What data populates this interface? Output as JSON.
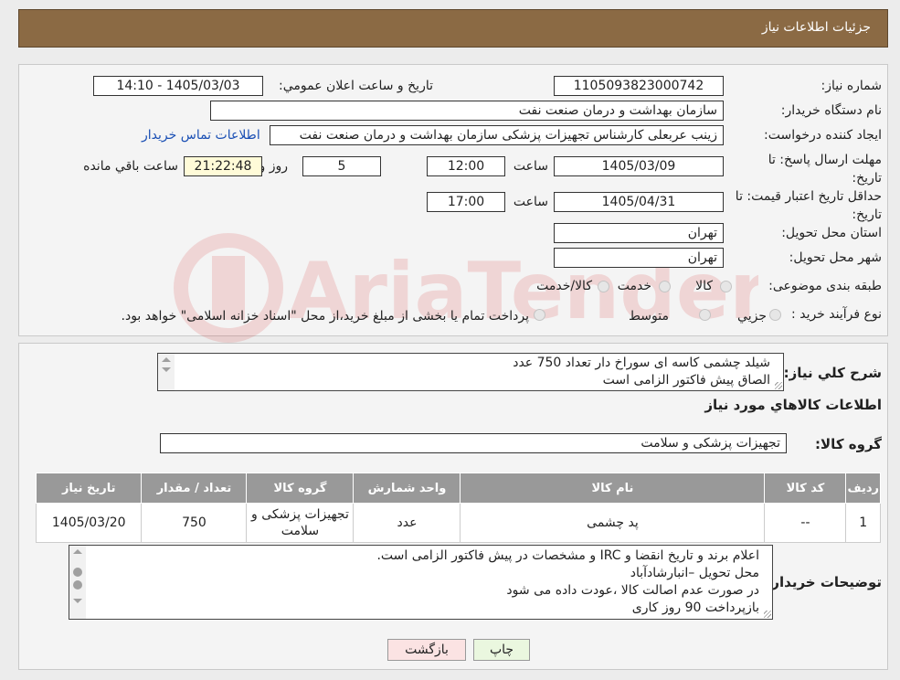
{
  "header": {
    "title": "جزئیات اطلاعات نیاز"
  },
  "form": {
    "need_number_label": "شماره نیاز:",
    "need_number": "1105093823000742",
    "announce_label": "تاريخ و ساعت اعلان عمومي:",
    "announce_value": "1405/03/03 - 14:10",
    "buyer_org_label": "نام دستگاه خريدار:",
    "buyer_org": "سازمان بهداشت و درمان صنعت نفت",
    "requester_label": "ايجاد کننده درخواست:",
    "requester": "زینب عربعلی کارشناس تجهیزات پزشکی سازمان بهداشت و درمان صنعت نفت",
    "contact_link": "اطلاعات تماس خريدار",
    "deadline_label": "مهلت ارسال پاسخ: تا تاريخ:",
    "deadline_date": "1405/03/09",
    "time_label": "ساعت",
    "deadline_time": "12:00",
    "days_value": "5",
    "days_label": "روز و",
    "countdown": "21:22:48",
    "remaining_label": "ساعت باقي مانده",
    "validity_label": "حداقل تاريخ اعتبار قيمت: تا تاريخ:",
    "validity_date": "1405/04/31",
    "validity_time": "17:00",
    "province_label": "استان محل تحويل:",
    "province": "تهران",
    "city_label": "شهر محل تحويل:",
    "city": "تهران",
    "category_label": "طبقه بندی موضوعی:",
    "category_options": [
      "کالا",
      "خدمت",
      "کالا/خدمت"
    ],
    "process_label": "نوع فرآيند خريد :",
    "process_options": [
      "جزيي",
      "متوسط"
    ],
    "payment_note": "پرداخت تمام يا بخشی از مبلغ خريد،از محل \"اسناد خزانه اسلامی\" خواهد بود."
  },
  "description": {
    "label": "شرح کلي نياز:",
    "lines": [
      "شیلد چشمی کاسه ای سوراخ دار تعداد 750 عدد",
      "الصاق پیش فاکتور الزامی است"
    ]
  },
  "goods": {
    "section_title": "اطلاعات کالاهاي مورد نياز",
    "group_label": "گروه کالا:",
    "group_value": "تجهیزات پزشکی و سلامت",
    "columns": [
      "رديف",
      "کد کالا",
      "نام کالا",
      "واحد شمارش",
      "گروه کالا",
      "تعداد / مقدار",
      "تاريخ نياز"
    ],
    "rows": [
      {
        "index": "1",
        "code": "--",
        "name": "پد چشمی",
        "unit": "عدد",
        "group": "تجهیزات پزشکی و سلامت",
        "qty": "750",
        "date": "1405/03/20"
      }
    ]
  },
  "buyer_notes": {
    "label": "توضيحات خريدار:",
    "lines": [
      "اعلام برند و تاریخ انقضا  و IRC  و مشخصات  در پیش فاکتور الزامی است.",
      "محل تحویل –انبارشادآباد",
      "در صورت عدم اصالت کالا ،عودت داده می شود",
      "بازپرداخت 90 روز کاری"
    ]
  },
  "buttons": {
    "print": "چاپ",
    "back": "بازگشت"
  },
  "colors": {
    "header": "#8b6a44",
    "print_bg": "#eaf7df",
    "back_bg": "#fbe3e3",
    "link": "#1a4fb4",
    "timer_bg": "#fffbd8"
  },
  "watermark": {
    "text": "AriaTender.neT"
  }
}
